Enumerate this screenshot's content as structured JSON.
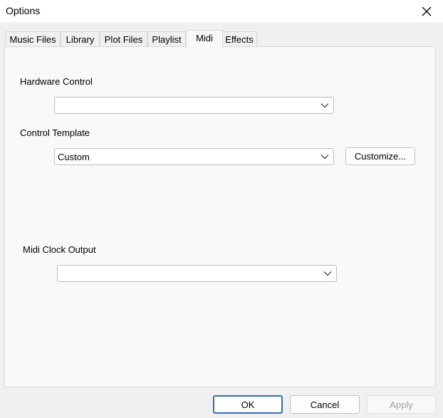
{
  "window": {
    "title": "Options"
  },
  "tabs": [
    {
      "label": "Music Files"
    },
    {
      "label": "Library"
    },
    {
      "label": "Plot Files"
    },
    {
      "label": "Playlist"
    },
    {
      "label": "Midi"
    },
    {
      "label": "Effects"
    }
  ],
  "active_tab": "Midi",
  "midi": {
    "hardware_control": {
      "label": "Hardware Control",
      "value": ""
    },
    "control_template": {
      "label": "Control Template",
      "value": "Custom",
      "customize_label": "Customize..."
    },
    "midi_clock_output": {
      "label": "Midi Clock Output",
      "value": ""
    }
  },
  "buttons": {
    "ok": "OK",
    "cancel": "Cancel",
    "apply": "Apply"
  },
  "icons": {
    "close": "close-icon",
    "dropdown": "chevron-down-icon"
  }
}
